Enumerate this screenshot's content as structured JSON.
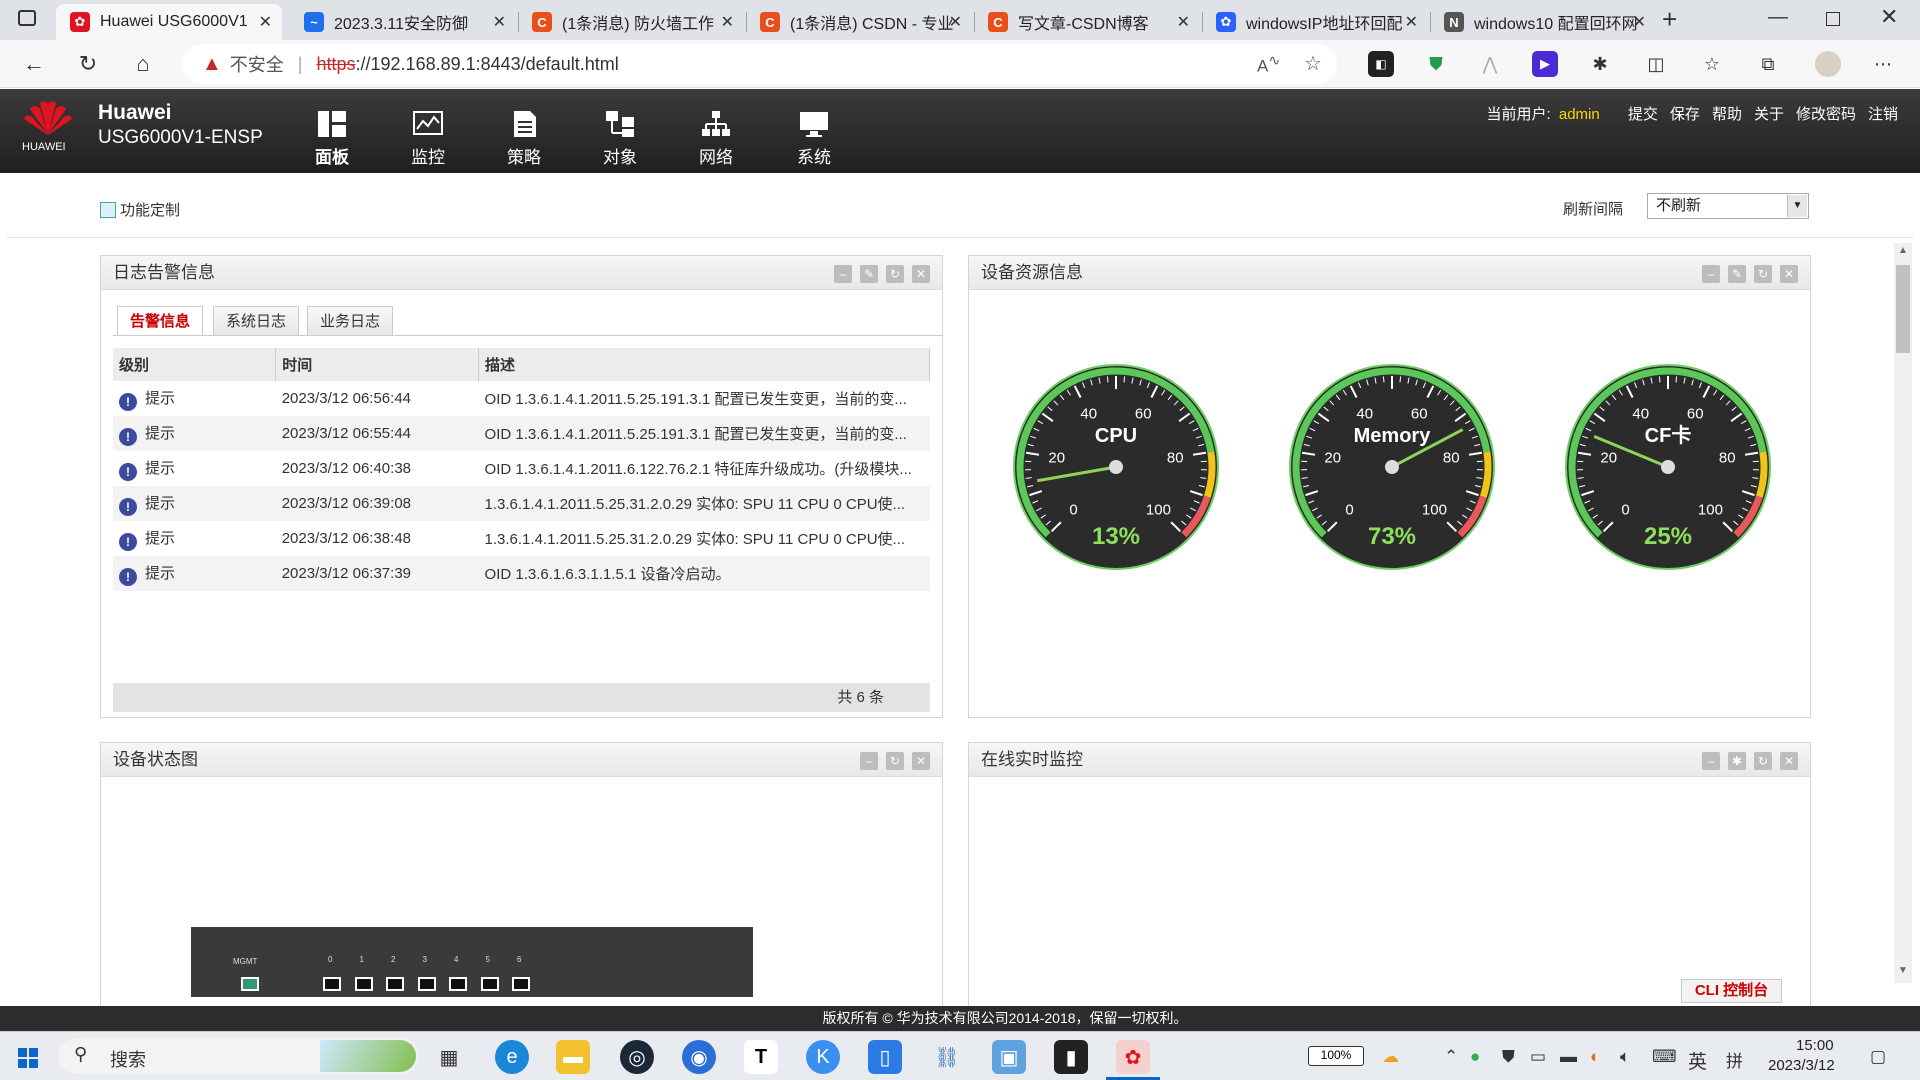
{
  "browser": {
    "tabs": [
      {
        "title": "Huawei USG6000V1",
        "icon": "huawei-logo-icon",
        "color": "#e0141e",
        "active": true
      },
      {
        "title": "2023.3.11安全防御",
        "icon": "doc-icon",
        "color": "#1f6feb",
        "active": false
      },
      {
        "title": "(1条消息) 防火墙工作",
        "icon": "csdn-c-icon",
        "color": "#e94e1b",
        "active": false
      },
      {
        "title": "(1条消息) CSDN - 专业",
        "icon": "csdn-c-icon",
        "color": "#e94e1b",
        "active": false
      },
      {
        "title": "写文章-CSDN博客",
        "icon": "csdn-c-icon",
        "color": "#e94e1b",
        "active": false
      },
      {
        "title": "windowsIP地址环回配",
        "icon": "baidu-paw-icon",
        "color": "#2a62ff",
        "active": false
      },
      {
        "title": "windows10 配置回环网",
        "icon": "zhihu-icon",
        "color": "#555555",
        "active": false
      }
    ],
    "warning": "不安全",
    "url_scheme": "https",
    "url_rest": "://192.168.89.1:8443/default.html"
  },
  "app": {
    "brand": "Huawei",
    "brand_small": "HUAWEI",
    "model": "USG6000V1-ENSP",
    "nav": [
      {
        "label": "面板",
        "icon": "dashboard-icon",
        "active": true
      },
      {
        "label": "监控",
        "icon": "monitor-icon",
        "active": false
      },
      {
        "label": "策略",
        "icon": "policy-icon",
        "active": false
      },
      {
        "label": "对象",
        "icon": "object-icon",
        "active": false
      },
      {
        "label": "网络",
        "icon": "network-icon",
        "active": false
      },
      {
        "label": "系统",
        "icon": "system-icon",
        "active": false
      }
    ],
    "user_label": "当前用户:",
    "username": "admin",
    "actions": [
      "提交",
      "保存",
      "帮助",
      "关于",
      "修改密码",
      "注销"
    ]
  },
  "toolbar": {
    "customize": "功能定制",
    "refresh_label": "刷新间隔",
    "refresh_value": "不刷新"
  },
  "log_panel": {
    "title": "日志告警信息",
    "tabs": [
      "告警信息",
      "系统日志",
      "业务日志"
    ],
    "columns": [
      "级别",
      "时间",
      "描述"
    ],
    "rows": [
      {
        "level": "提示",
        "time": "2023/3/12 06:56:44",
        "desc": "OID 1.3.6.1.4.1.2011.5.25.191.3.1 配置已发生变更，当前的变..."
      },
      {
        "level": "提示",
        "time": "2023/3/12 06:55:44",
        "desc": "OID 1.3.6.1.4.1.2011.5.25.191.3.1 配置已发生变更，当前的变..."
      },
      {
        "level": "提示",
        "time": "2023/3/12 06:40:38",
        "desc": "OID 1.3.6.1.4.1.2011.6.122.76.2.1 特征库升级成功。(升级模块..."
      },
      {
        "level": "提示",
        "time": "2023/3/12 06:39:08",
        "desc": "1.3.6.1.4.1.2011.5.25.31.2.0.29 实体0: SPU 11 CPU 0 CPU使..."
      },
      {
        "level": "提示",
        "time": "2023/3/12 06:38:48",
        "desc": "1.3.6.1.4.1.2011.5.25.31.2.0.29 实体0: SPU 11 CPU 0 CPU使..."
      },
      {
        "level": "提示",
        "time": "2023/3/12 06:37:39",
        "desc": "OID 1.3.6.1.6.3.1.1.5.1 设备冷启动。"
      }
    ],
    "footer": "共 6 条"
  },
  "resource_panel": {
    "title": "设备资源信息",
    "gauges": [
      {
        "label": "CPU",
        "value": 13
      },
      {
        "label": "Memory",
        "value": 73
      },
      {
        "label": "CF卡",
        "value": 25
      }
    ],
    "ticks": [
      "0",
      "20",
      "40",
      "60",
      "80",
      "100"
    ]
  },
  "status_panel": {
    "title": "设备状态图",
    "mgmt_label": "MGMT",
    "ports": [
      "0",
      "1",
      "2",
      "3",
      "4",
      "5",
      "6"
    ]
  },
  "monitor_panel": {
    "title": "在线实时监控"
  },
  "cli_button": "CLI 控制台",
  "copyright": "版权所有 © 华为技术有限公司2014-2018，保留一切权利。",
  "taskbar": {
    "search": "搜索",
    "battery": "100%",
    "lang": "英",
    "ime": "拼",
    "time": "15:00",
    "date": "2023/3/12"
  }
}
